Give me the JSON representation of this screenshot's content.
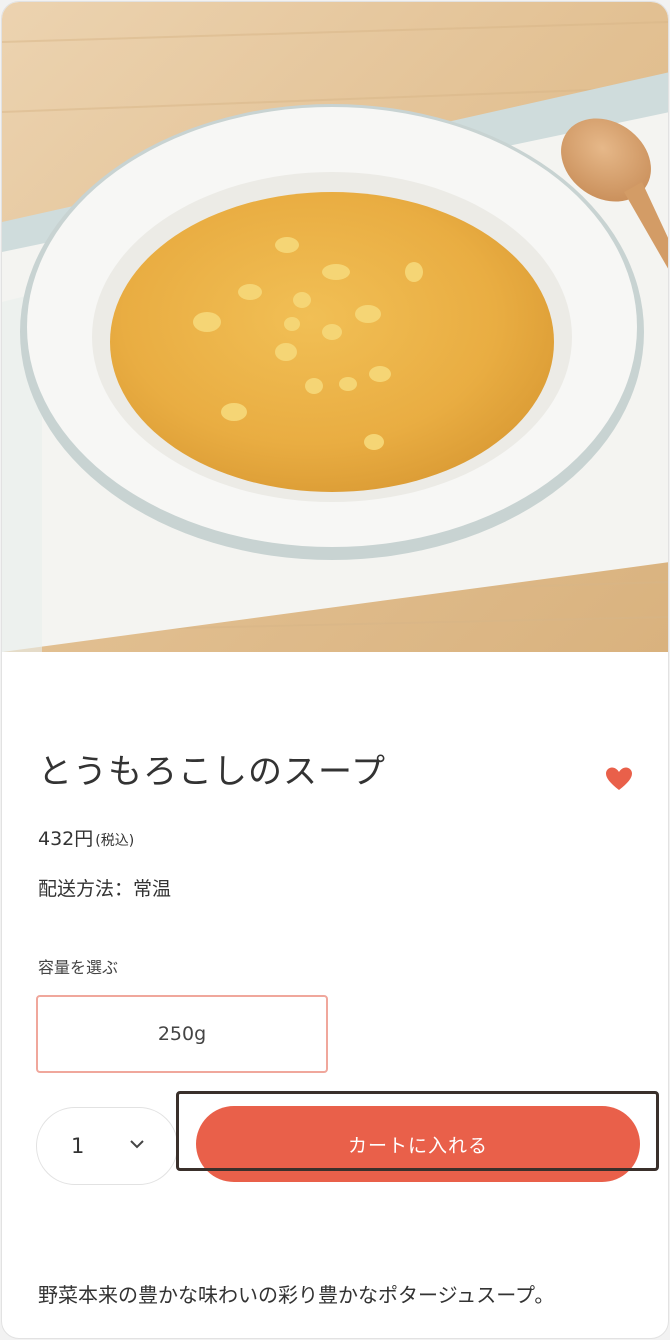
{
  "product": {
    "image_alt": "corn soup in white bowl with wooden spoon",
    "name": "とうもろこしのスープ",
    "price": "432円",
    "tax_note": "(税込)",
    "shipping": "配送方法：常温",
    "favorite_icon": "heart-icon",
    "accent_color": "#e9604a"
  },
  "capacity": {
    "label": "容量を選ぶ",
    "selected": "250g"
  },
  "quantity": {
    "value": "1",
    "icon": "chevron-down-icon"
  },
  "cart": {
    "button_label": "カートに入れる"
  },
  "description": "野菜本来の豊かな味わいの彩り豊かなポタージュスープ。"
}
